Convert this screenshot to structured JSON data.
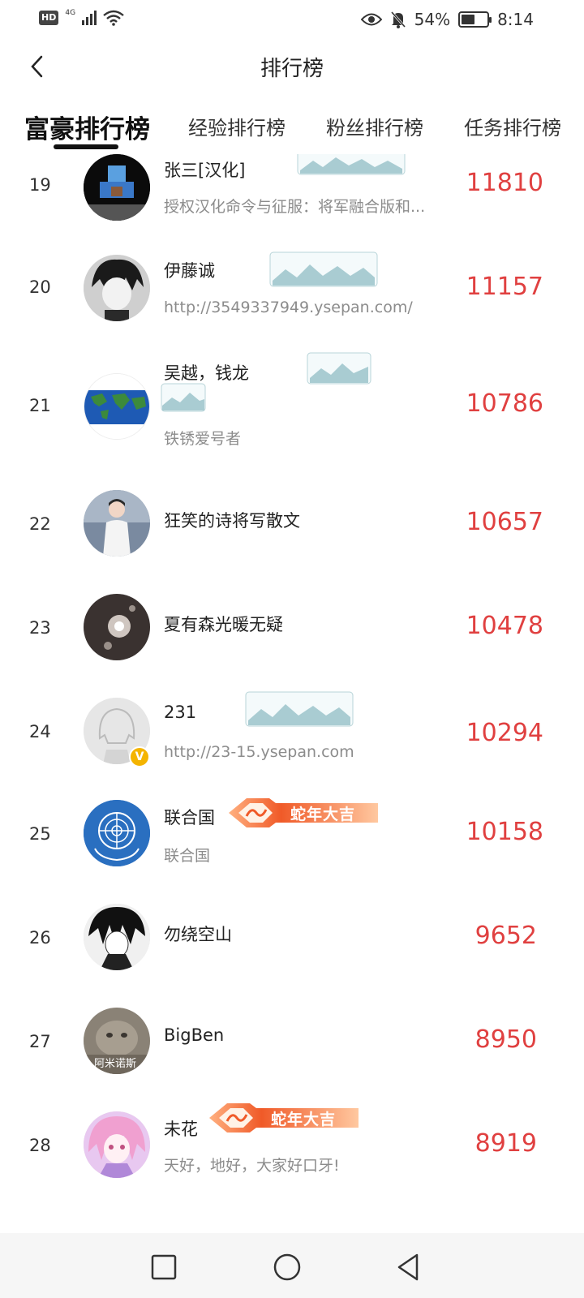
{
  "status_bar": {
    "network_badge": "HD",
    "network_type": "4G",
    "battery_percent": "54%",
    "battery_level": 0.54,
    "time": "8:14"
  },
  "header": {
    "title": "排行榜"
  },
  "tabs": [
    {
      "label": "富豪排行榜",
      "active": true
    },
    {
      "label": "经验排行榜",
      "active": false
    },
    {
      "label": "粉丝排行榜",
      "active": false
    },
    {
      "label": "任务排行榜",
      "active": false
    }
  ],
  "badge_text": "蛇年大吉",
  "ranking": [
    {
      "rank": "19",
      "name": "张三[汉化]",
      "subtitle": "授权汉化命令与征服：将军融合版和...",
      "score": "11810"
    },
    {
      "rank": "20",
      "name": "伊藤诚",
      "subtitle": "http://3549337949.ysepan.com/",
      "score": "11157"
    },
    {
      "rank": "21",
      "name": "吴越，钱龙",
      "subtitle": "铁锈爱号者",
      "score": "10786"
    },
    {
      "rank": "22",
      "name": "狂笑的诗将写散文",
      "subtitle": "",
      "score": "10657"
    },
    {
      "rank": "23",
      "name": "夏有森光暖无疑",
      "subtitle": "",
      "score": "10478"
    },
    {
      "rank": "24",
      "name": "231",
      "subtitle": "http://23-15.ysepan.com",
      "score": "10294"
    },
    {
      "rank": "25",
      "name": "联合国",
      "subtitle": "联合国",
      "score": "10158"
    },
    {
      "rank": "26",
      "name": "勿绕空山",
      "subtitle": "",
      "score": "9652"
    },
    {
      "rank": "27",
      "name": "BigBen",
      "subtitle": "",
      "score": "8950",
      "avatar_caption": "阿米诺斯"
    },
    {
      "rank": "28",
      "name": "未花",
      "subtitle": "天好，地好，大家好口牙!",
      "score": "8919"
    }
  ],
  "colors": {
    "score": "#e04040",
    "subtitle": "#8c8c8c",
    "badge_orange": "#f05a28",
    "verified": "#f4b400"
  },
  "icons": {
    "back": "chevron-left-icon",
    "nav_recent": "square-icon",
    "nav_home": "circle-icon",
    "nav_back": "triangle-back-icon"
  }
}
